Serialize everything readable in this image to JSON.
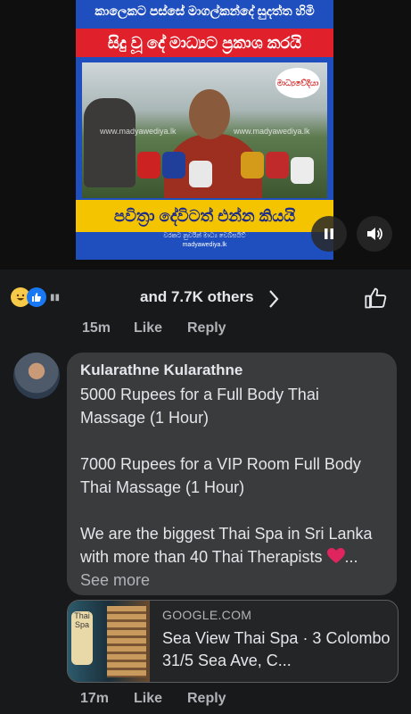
{
  "video": {
    "headline_top": "කාලෙකට පස්සේ මාගල්කන්දේ සුදත්ත හිමි",
    "headline_red": "සිදු වූ දේ මාධ්‍යට ප්‍රකාශ කරයි",
    "headline_bottom": "පවිත්‍රා දේවිටත් එන්න කියයි",
    "watermark_left": "www.madyawediya.lk",
    "watermark_right": "www.madyawediya.lk",
    "logo_text": "මාධ්‍යවේදියා",
    "footer_line1": "වරකට නුවරින් මාධ්‍ය වෙබ්සයිට්",
    "footer_line2": "madyawediya.lk",
    "pause_icon": "pause-icon",
    "volume_icon": "volume-icon"
  },
  "reactions": {
    "icons": [
      "haha-emoji",
      "like-emoji"
    ],
    "summary": "and 7.7K others",
    "chevron_icon": "chevron-right-icon",
    "like_icon": "thumbs-up-icon"
  },
  "prev_comment_meta": {
    "time": "15m",
    "like": "Like",
    "reply": "Reply"
  },
  "comment": {
    "author": "Kularathne Kularathne",
    "paragraph1": "5000 Rupees for a Full Body Thai Massage (1 Hour)",
    "paragraph2": "7000 Rupees for a VIP Room Full Body Thai Massage (1 Hour)",
    "paragraph3": "We are the biggest Thai Spa in Sri Lanka with more than 40 Thai Therapists",
    "ellipsis": "...",
    "see_more": "See more",
    "heart_icon": "red-heart-icon",
    "link": {
      "domain": "GOOGLE.COM",
      "title": "Sea View Thai Spa · 3 Colombo 31/5 Sea Ave, C...",
      "thumb_text": "Thai Spa"
    },
    "time": "17m",
    "like": "Like",
    "reply": "Reply"
  },
  "colors": {
    "background": "#18191a",
    "bubble": "#3a3b3c",
    "secondary_text": "#b0b3b8",
    "primary_text": "#e4e6eb",
    "heart": "#e0245e",
    "like_blue": "#1877f2"
  }
}
